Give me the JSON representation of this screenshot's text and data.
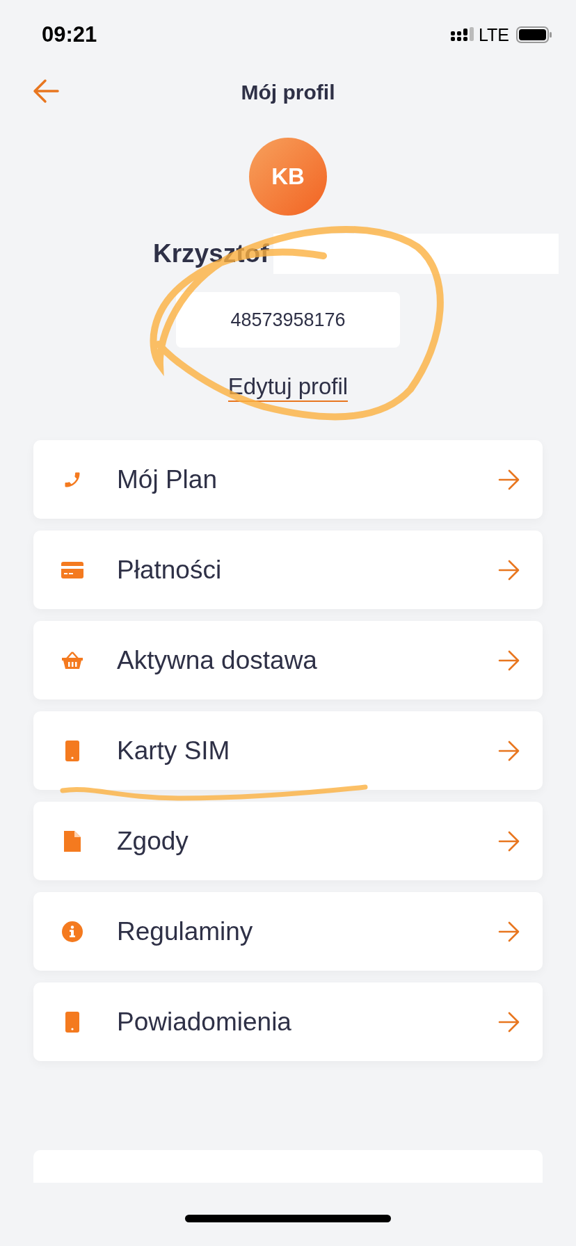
{
  "status_bar": {
    "time": "09:21",
    "network": "LTE"
  },
  "header": {
    "title": "Mój profil"
  },
  "profile": {
    "initials": "KB",
    "name": "Krzysztof",
    "phone": "48573958176",
    "edit_link": "Edytuj profil"
  },
  "menu": [
    {
      "label": "Mój Plan"
    },
    {
      "label": "Płatności"
    },
    {
      "label": "Aktywna dostawa"
    },
    {
      "label": "Karty SIM"
    },
    {
      "label": "Zgody"
    },
    {
      "label": "Regulaminy"
    },
    {
      "label": "Powiadomienia"
    }
  ]
}
